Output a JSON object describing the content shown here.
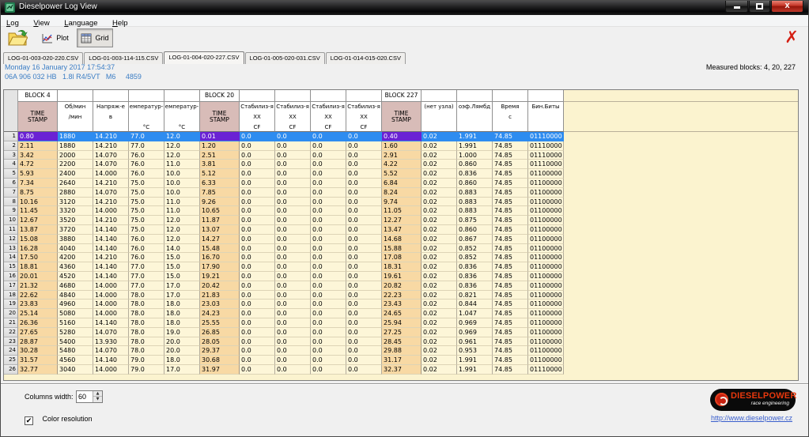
{
  "window": {
    "title": "Dieselpower Log View"
  },
  "menu": {
    "items": [
      "Log",
      "View",
      "Language",
      "Help"
    ]
  },
  "toolbar": {
    "plot_label": "Plot",
    "grid_label": "Grid",
    "close_glyph": "✗"
  },
  "tabs": [
    {
      "label": "LOG-01-003-020-220.CSV",
      "active": false
    },
    {
      "label": "LOG-01-003-114-115.CSV",
      "active": false
    },
    {
      "label": "LOG-01-004-020-227.CSV",
      "active": true
    },
    {
      "label": "LOG-01-005-020-031.CSV",
      "active": false
    },
    {
      "label": "LOG-01-014-015-020.CSV",
      "active": false
    }
  ],
  "info": {
    "line1": "Monday 16 January 2017 17:54:37",
    "line2": "06A 906 032 HB   1.8l R4/5VT   M6     4859",
    "measured_blocks": "Measured blocks: 4, 20, 227"
  },
  "grid": {
    "selected_row": 1,
    "columns": [
      {
        "block": "BLOCK 4",
        "ts": true,
        "lines": [
          "TIME",
          "STAMP"
        ]
      },
      {
        "block": "",
        "ts": false,
        "lines": [
          "Об/мин",
          "/мин",
          ""
        ]
      },
      {
        "block": "",
        "ts": false,
        "lines": [
          "Напряж-е",
          "в",
          ""
        ]
      },
      {
        "block": "",
        "ts": false,
        "lines": [
          "емператур-",
          "",
          "°C"
        ]
      },
      {
        "block": "",
        "ts": false,
        "lines": [
          "емператур-",
          "",
          "°C"
        ]
      },
      {
        "block": "BLOCK 20",
        "ts": true,
        "lines": [
          "TIME",
          "STAMP"
        ]
      },
      {
        "block": "",
        "ts": false,
        "lines": [
          "Стабилиз-я",
          "ХХ",
          "CF"
        ]
      },
      {
        "block": "",
        "ts": false,
        "lines": [
          "Стабилиз-я",
          "ХХ",
          "CF"
        ]
      },
      {
        "block": "",
        "ts": false,
        "lines": [
          "Стабилиз-я",
          "ХХ",
          "CF"
        ]
      },
      {
        "block": "",
        "ts": false,
        "lines": [
          "Стабилиз-я",
          "ХХ",
          "CF"
        ]
      },
      {
        "block": "BLOCK 227",
        "ts": true,
        "lines": [
          "TIME",
          "STAMP"
        ]
      },
      {
        "block": "",
        "ts": false,
        "lines": [
          "(нет узла)",
          "",
          ""
        ]
      },
      {
        "block": "",
        "ts": false,
        "lines": [
          "оэф.Лямбд",
          "",
          ""
        ]
      },
      {
        "block": "",
        "ts": false,
        "lines": [
          "Время",
          "с",
          ""
        ]
      },
      {
        "block": "",
        "ts": false,
        "lines": [
          "Бин.Биты",
          "",
          ""
        ]
      }
    ],
    "rows": [
      [
        "0.80",
        "1880",
        "14.210",
        "77.0",
        "12.0",
        "0.01",
        "0.0",
        "0.0",
        "0.0",
        "0.0",
        "0.40",
        "0.02",
        "1.991",
        "74.85",
        "01110000"
      ],
      [
        "2.11",
        "1880",
        "14.210",
        "77.0",
        "12.0",
        "1.20",
        "0.0",
        "0.0",
        "0.0",
        "0.0",
        "1.60",
        "0.02",
        "1.991",
        "74.85",
        "01110000"
      ],
      [
        "3.42",
        "2000",
        "14.070",
        "76.0",
        "12.0",
        "2.51",
        "0.0",
        "0.0",
        "0.0",
        "0.0",
        "2.91",
        "0.02",
        "1.000",
        "74.85",
        "01110000"
      ],
      [
        "4.72",
        "2200",
        "14.070",
        "76.0",
        "11.0",
        "3.81",
        "0.0",
        "0.0",
        "0.0",
        "0.0",
        "4.22",
        "0.02",
        "0.860",
        "74.85",
        "01110000"
      ],
      [
        "5.93",
        "2400",
        "14.000",
        "76.0",
        "10.0",
        "5.12",
        "0.0",
        "0.0",
        "0.0",
        "0.0",
        "5.52",
        "0.02",
        "0.836",
        "74.85",
        "01100000"
      ],
      [
        "7.34",
        "2640",
        "14.210",
        "75.0",
        "10.0",
        "6.33",
        "0.0",
        "0.0",
        "0.0",
        "0.0",
        "6.84",
        "0.02",
        "0.860",
        "74.85",
        "01100000"
      ],
      [
        "8.75",
        "2880",
        "14.070",
        "75.0",
        "10.0",
        "7.85",
        "0.0",
        "0.0",
        "0.0",
        "0.0",
        "8.24",
        "0.02",
        "0.883",
        "74.85",
        "01100000"
      ],
      [
        "10.16",
        "3120",
        "14.210",
        "75.0",
        "11.0",
        "9.26",
        "0.0",
        "0.0",
        "0.0",
        "0.0",
        "9.74",
        "0.02",
        "0.883",
        "74.85",
        "01100000"
      ],
      [
        "11.45",
        "3320",
        "14.000",
        "75.0",
        "11.0",
        "10.65",
        "0.0",
        "0.0",
        "0.0",
        "0.0",
        "11.05",
        "0.02",
        "0.883",
        "74.85",
        "01100000"
      ],
      [
        "12.67",
        "3520",
        "14.210",
        "75.0",
        "12.0",
        "11.87",
        "0.0",
        "0.0",
        "0.0",
        "0.0",
        "12.27",
        "0.02",
        "0.875",
        "74.85",
        "01100000"
      ],
      [
        "13.87",
        "3720",
        "14.140",
        "75.0",
        "12.0",
        "13.07",
        "0.0",
        "0.0",
        "0.0",
        "0.0",
        "13.47",
        "0.02",
        "0.860",
        "74.85",
        "01100000"
      ],
      [
        "15.08",
        "3880",
        "14.140",
        "76.0",
        "12.0",
        "14.27",
        "0.0",
        "0.0",
        "0.0",
        "0.0",
        "14.68",
        "0.02",
        "0.867",
        "74.85",
        "01100000"
      ],
      [
        "16.28",
        "4040",
        "14.140",
        "76.0",
        "14.0",
        "15.48",
        "0.0",
        "0.0",
        "0.0",
        "0.0",
        "15.88",
        "0.02",
        "0.852",
        "74.85",
        "01100000"
      ],
      [
        "17.50",
        "4200",
        "14.210",
        "76.0",
        "15.0",
        "16.70",
        "0.0",
        "0.0",
        "0.0",
        "0.0",
        "17.08",
        "0.02",
        "0.852",
        "74.85",
        "01100000"
      ],
      [
        "18.81",
        "4360",
        "14.140",
        "77.0",
        "15.0",
        "17.90",
        "0.0",
        "0.0",
        "0.0",
        "0.0",
        "18.31",
        "0.02",
        "0.836",
        "74.85",
        "01100000"
      ],
      [
        "20.01",
        "4520",
        "14.140",
        "77.0",
        "15.0",
        "19.21",
        "0.0",
        "0.0",
        "0.0",
        "0.0",
        "19.61",
        "0.02",
        "0.836",
        "74.85",
        "01100000"
      ],
      [
        "21.32",
        "4680",
        "14.000",
        "77.0",
        "17.0",
        "20.42",
        "0.0",
        "0.0",
        "0.0",
        "0.0",
        "20.82",
        "0.02",
        "0.836",
        "74.85",
        "01100000"
      ],
      [
        "22.62",
        "4840",
        "14.000",
        "78.0",
        "17.0",
        "21.83",
        "0.0",
        "0.0",
        "0.0",
        "0.0",
        "22.23",
        "0.02",
        "0.821",
        "74.85",
        "01100000"
      ],
      [
        "23.83",
        "4960",
        "14.000",
        "78.0",
        "18.0",
        "23.03",
        "0.0",
        "0.0",
        "0.0",
        "0.0",
        "23.43",
        "0.02",
        "0.844",
        "74.85",
        "01100000"
      ],
      [
        "25.14",
        "5080",
        "14.000",
        "78.0",
        "18.0",
        "24.23",
        "0.0",
        "0.0",
        "0.0",
        "0.0",
        "24.65",
        "0.02",
        "1.047",
        "74.85",
        "01100000"
      ],
      [
        "26.36",
        "5160",
        "14.140",
        "78.0",
        "18.0",
        "25.55",
        "0.0",
        "0.0",
        "0.0",
        "0.0",
        "25.94",
        "0.02",
        "0.969",
        "74.85",
        "01100000"
      ],
      [
        "27.65",
        "5280",
        "14.070",
        "78.0",
        "19.0",
        "26.85",
        "0.0",
        "0.0",
        "0.0",
        "0.0",
        "27.25",
        "0.02",
        "0.969",
        "74.85",
        "01100000"
      ],
      [
        "28.87",
        "5400",
        "13.930",
        "78.0",
        "20.0",
        "28.05",
        "0.0",
        "0.0",
        "0.0",
        "0.0",
        "28.45",
        "0.02",
        "0.961",
        "74.85",
        "01100000"
      ],
      [
        "30.28",
        "5480",
        "14.070",
        "78.0",
        "20.0",
        "29.37",
        "0.0",
        "0.0",
        "0.0",
        "0.0",
        "29.88",
        "0.02",
        "0.953",
        "74.85",
        "01100000"
      ],
      [
        "31.57",
        "4560",
        "14.140",
        "79.0",
        "18.0",
        "30.68",
        "0.0",
        "0.0",
        "0.0",
        "0.0",
        "31.17",
        "0.02",
        "1.991",
        "74.85",
        "01100000"
      ],
      [
        "32.77",
        "3040",
        "14.000",
        "79.0",
        "17.0",
        "31.97",
        "0.0",
        "0.0",
        "0.0",
        "0.0",
        "32.37",
        "0.02",
        "1.991",
        "74.85",
        "01110000"
      ]
    ]
  },
  "bottom": {
    "columns_width_label": "Columns width:",
    "columns_width_value": "60",
    "color_resolution_label": "Color resolution",
    "checkbox_checked": "✔",
    "logo_title": "DIESELPOWER",
    "logo_sub": "race engineering",
    "site_link": "http://www.dieselpower.cz"
  },
  "colors": {
    "selected_row": "#2e8cf0",
    "selected_timestamp": "#6a22d4",
    "timestamp_column": "#f8d9a4",
    "data_cell": "#fdf6d8",
    "timestamp_header": "#d8bcb8",
    "info_text": "#3b7dc4",
    "logo_red": "#e8380d",
    "link": "#3a5fcd",
    "close_x": "#d41e12"
  }
}
